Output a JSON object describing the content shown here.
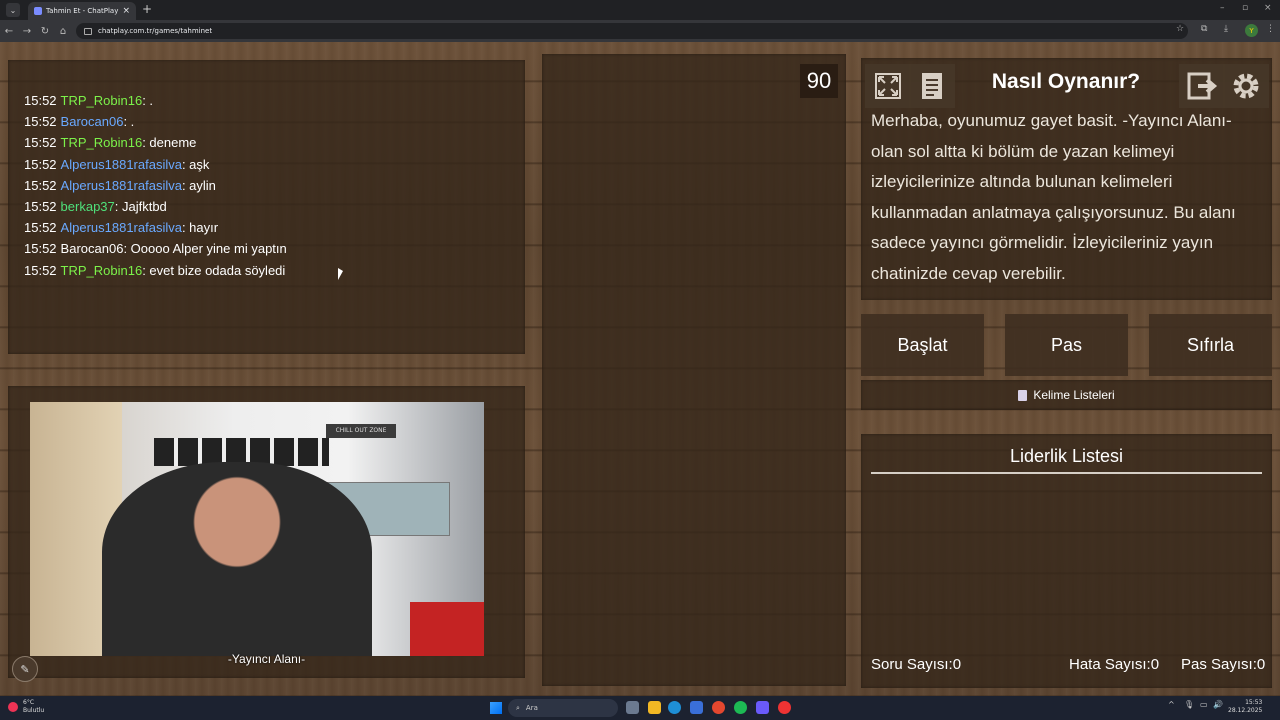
{
  "browser": {
    "tab_title": "Tahmin Et - ChatPlay",
    "url": "chatplay.com.tr/games/tahminet"
  },
  "chat": {
    "messages": [
      {
        "time": "15:52",
        "user": "TRP_Robin16",
        "text": ": .",
        "color": "#7cf24a"
      },
      {
        "time": "15:52",
        "user": "Barocan06",
        "text": ": .",
        "color": "#6aa9ff"
      },
      {
        "time": "15:52",
        "user": "TRP_Robin16",
        "text": ": deneme",
        "color": "#7cf24a"
      },
      {
        "time": "15:52",
        "user": "Alperus1881rafasilva",
        "text": ": aşk",
        "color": "#6aa9ff"
      },
      {
        "time": "15:52",
        "user": "Alperus1881rafasilva",
        "text": ": aylin",
        "color": "#6aa9ff"
      },
      {
        "time": "15:52",
        "user": "berkap37",
        "text": ": Jajfktbd",
        "color": "#4fe07a"
      },
      {
        "time": "15:52",
        "user": "Alperus1881rafasilva",
        "text": ": hayır",
        "color": "#6aa9ff"
      },
      {
        "time": "15:52",
        "user": "Barocan06",
        "text": ": Ooooo Alper yine mi yaptın",
        "color": "#ffffff"
      },
      {
        "time": "15:52",
        "user": "TRP_Robin16",
        "text": ": evet bize odada söyledi",
        "color": "#7cf24a"
      }
    ]
  },
  "streamer": {
    "label": "-Yayıncı Alanı-",
    "cam_sign": "CHILL OUT ZONE"
  },
  "game": {
    "timer": "90"
  },
  "howto": {
    "title": "Nasıl Oynanır?",
    "text": "Merhaba, oyunumuz gayet basit. -Yayıncı Alanı- olan sol altta ki bölüm de yazan kelimeyi izleyicilerinize altında bulunan kelimeleri kullanmadan anlatmaya çalışıyorsunuz. Bu alanı sadece yayıncı görmelidir. İzleyicileriniz yayın chatinizde cevap verebilir."
  },
  "buttons": {
    "start": "Başlat",
    "pass": "Pas",
    "reset": "Sıfırla",
    "word_lists": "Kelime Listeleri"
  },
  "leaderboard": {
    "title": "Liderlik Listesi",
    "question_count": "Soru Sayısı:0",
    "error_count": "Hata Sayısı:0",
    "pass_count": "Pas Sayısı:0"
  },
  "taskbar": {
    "temp": "6°C",
    "weather": "Bulutlu",
    "search": "Ara",
    "time": "15:53",
    "date": "28.12.2025"
  }
}
